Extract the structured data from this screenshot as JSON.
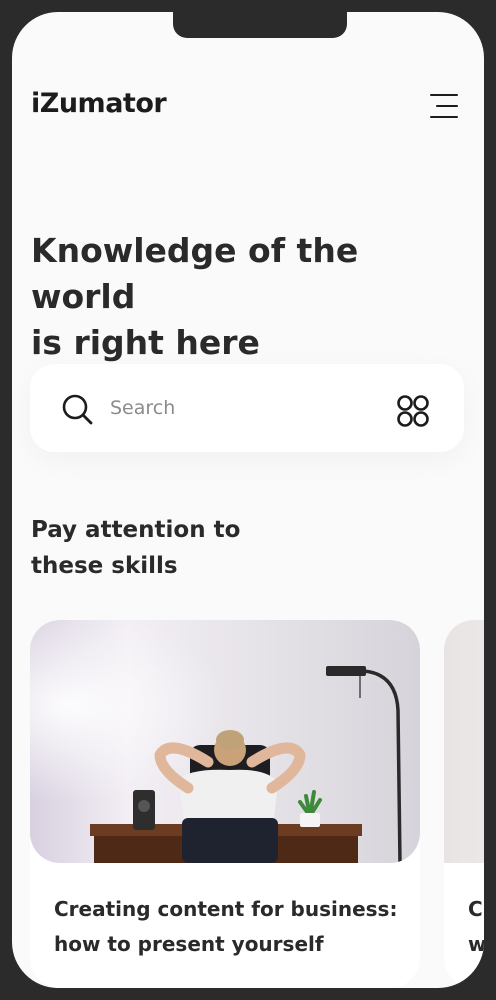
{
  "app": {
    "brand": "iZumator"
  },
  "hero": {
    "line1": "Knowledge of the world",
    "line2": "is right here"
  },
  "search": {
    "placeholder": "Search"
  },
  "section": {
    "line1": "Pay attention to",
    "line2": "these skills"
  },
  "cards": [
    {
      "title_line1": "Creating content for business:",
      "title_line2": "how to present yourself"
    },
    {
      "title_line1": "C",
      "title_line2": "w"
    }
  ],
  "icons": {
    "menu": "menu-icon",
    "search": "search-icon",
    "grid": "grid-icon"
  },
  "colors": {
    "text": "#2a2a2a",
    "background": "#fafafa",
    "frame": "#2b2b2b",
    "placeholder": "#8b8b8b"
  }
}
